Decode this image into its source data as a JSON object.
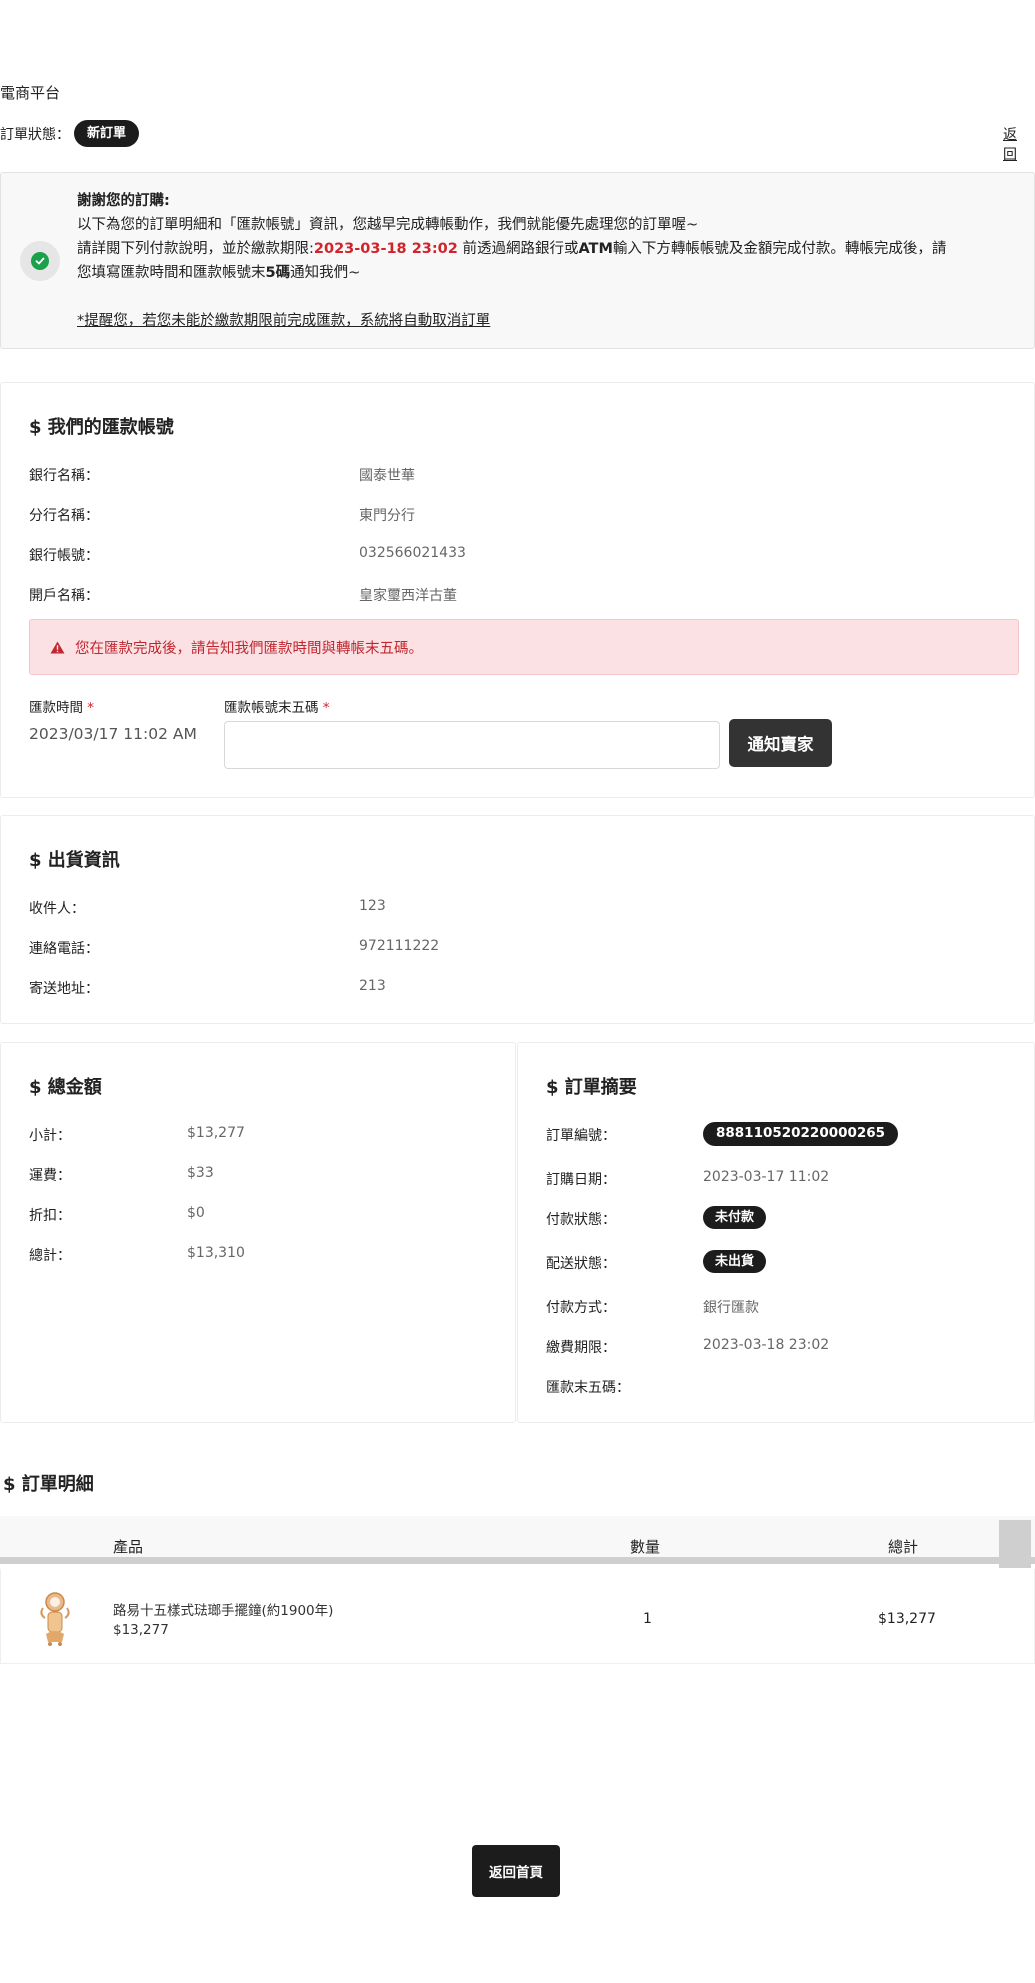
{
  "site": {
    "title": "電商平台"
  },
  "status": {
    "label": "訂單狀態：",
    "badge": "新訂單",
    "back": "返回"
  },
  "notice": {
    "line1": "謝謝您的訂購:",
    "line2": "以下為您的訂單明細和「匯款帳號」資訊，您越早完成轉帳動作，我們就能優先處理您的訂單喔~",
    "line3_prefix": "請詳閱下列付款說明，並於繳款期限:",
    "deadline": "2023-03-18 23:02",
    "line3_suffix_a": "前透過網路銀行或",
    "atm": "ATM",
    "line3_suffix_b": "輸入下方轉帳帳號及金額完成付款。轉帳完成後，請",
    "line4_a": "您填寫匯款時間和匯款帳號末",
    "line4_b": "5碼",
    "line4_c": "通知我們~",
    "reminder": "*提醒您，若您未能於繳款期限前完成匯款，系統將自動取消訂單"
  },
  "bank": {
    "title": "$ 我們的匯款帳號",
    "rows": [
      {
        "label": "銀行名稱：",
        "value": "國泰世華"
      },
      {
        "label": "分行名稱：",
        "value": "東門分行"
      },
      {
        "label": "銀行帳號：",
        "value": "032566021433"
      },
      {
        "label": "開戶名稱：",
        "value": "皇家璽西洋古董"
      }
    ],
    "alert": "您在匯款完成後，請告知我們匯款時間與轉帳末五碼。",
    "time_label": "匯款時間",
    "time_value": "2023/03/17 11:02 AM",
    "account_label": "匯款帳號末五碼",
    "required_mark": "*",
    "account_value": "",
    "notify_button": "通知賣家"
  },
  "shipping": {
    "title": "$ 出貨資訊",
    "rows": [
      {
        "label": "收件人：",
        "value": "123"
      },
      {
        "label": "連絡電話：",
        "value": "972111222"
      },
      {
        "label": "寄送地址：",
        "value": "213"
      }
    ]
  },
  "totals": {
    "title": "$ 總金額",
    "rows": [
      {
        "label": "小計：",
        "value": "$13,277"
      },
      {
        "label": "運費：",
        "value": "$33"
      },
      {
        "label": "折扣：",
        "value": "$0"
      },
      {
        "label": "總計：",
        "value": "$13,310"
      }
    ]
  },
  "summary": {
    "title": "$ 訂單摘要",
    "order_no_label": "訂單編號：",
    "order_no": "888110520220000265",
    "date_label": "訂購日期：",
    "date": "2023-03-17 11:02",
    "pay_status_label": "付款狀態：",
    "pay_status": "未付款",
    "ship_status_label": "配送狀態：",
    "ship_status": "未出貨",
    "pay_method_label": "付款方式：",
    "pay_method": "銀行匯款",
    "deadline_label": "繳費期限：",
    "deadline": "2023-03-18 23:02",
    "last5_label": "匯款末五碼：",
    "last5": ""
  },
  "details": {
    "title": "$ 訂單明細",
    "headers": {
      "product": "產品",
      "qty": "數量",
      "total": "總計"
    },
    "items": [
      {
        "name": "路易十五樣式琺瑯手擺鐘(約1900年)",
        "price": "$13,277",
        "qty": "1",
        "total": "$13,277"
      }
    ]
  },
  "footer": {
    "home_button": "返回首頁"
  },
  "colors": {
    "accent_red": "#d2232a",
    "dark": "#1c1c1c",
    "success": "#1aa24a",
    "alert_bg": "#fbe1e4"
  },
  "icons": [
    "check-circle-icon",
    "warning-triangle-icon",
    "product-thumbnail"
  ]
}
